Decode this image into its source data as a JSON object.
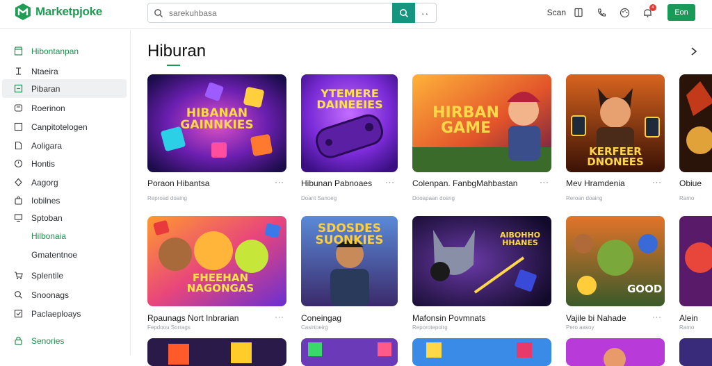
{
  "app": {
    "name": "Marketpjoke",
    "brand_color": "#1f9d55"
  },
  "search": {
    "placeholder": "sarekuhbasa",
    "more_label": "··"
  },
  "header": {
    "scan_label": "Scan",
    "icons": [
      "book-icon",
      "phone-icon",
      "palette-icon",
      "bell-icon"
    ],
    "notification_badge": "4",
    "primary_button": "Eon"
  },
  "sidebar": {
    "items": [
      {
        "label": "Hibontanpan",
        "icon": "store-icon"
      },
      {
        "label": "Ntaeira",
        "icon": "i-cursor-icon"
      },
      {
        "label": "Pibaran",
        "icon": "square-icon"
      },
      {
        "label": "Roerinon",
        "icon": "tag-icon"
      },
      {
        "label": "Canpitotelogen",
        "icon": "box-icon"
      },
      {
        "label": "Aoligara",
        "icon": "file-icon"
      },
      {
        "label": "Hontis",
        "icon": "clock-icon"
      },
      {
        "label": "Aagorg",
        "icon": "diamond-icon"
      },
      {
        "label": "Iobilnes",
        "icon": "bag-icon"
      },
      {
        "label": "Sptoban",
        "icon": "monitor-icon"
      },
      {
        "label": "Hilbonaia",
        "icon": ""
      },
      {
        "label": "Gmatentnoe",
        "icon": ""
      },
      {
        "label": "Splentile",
        "icon": "cart-icon"
      },
      {
        "label": "Snoonags",
        "icon": "search-alt-icon"
      },
      {
        "label": "Paclaeploays",
        "icon": "check-square-icon"
      },
      {
        "label": "Senories",
        "icon": "lock-icon"
      }
    ]
  },
  "main": {
    "title": "Hiburan",
    "cards": [
      {
        "title": "Poraon Hibantsa",
        "subtitle": "Reproad doaing",
        "art_text": "HIBANAN GAINNKIES"
      },
      {
        "title": "Hibunan Pabnoaes",
        "subtitle": "Doant Sanoeg",
        "art_text": "YTEMERE DAINEEIES"
      },
      {
        "title": "Colenpan. FanbgMahbastan",
        "subtitle": "Dooapaan dosng",
        "art_text": "HIRBAN GAME"
      },
      {
        "title": "Mev Hramdenia",
        "subtitle": "Reroan doaing",
        "art_text": "KERFEER DNONEES"
      },
      {
        "title": "Obiue",
        "subtitle": "Ramo",
        "art_text": ""
      },
      {
        "title": "Rpaunags Nort Inbrarian",
        "subtitle": "Fepdoou Sorrags",
        "art_text": "FHEEHAN NAGONGAS"
      },
      {
        "title": "Coneingag",
        "subtitle": "Casirtoeirg",
        "art_text": "SDOSDES SUONKIES"
      },
      {
        "title": "Mafonsin Povmnats",
        "subtitle": "Reporotepoirg",
        "art_text": "AIBOHHO HHANES"
      },
      {
        "title": "Vajile bi Nahade",
        "subtitle": "Pero aasoy",
        "art_text": "GOOD"
      },
      {
        "title": "Alein",
        "subtitle": "Ramo",
        "art_text": ""
      }
    ],
    "more_label": "···"
  }
}
